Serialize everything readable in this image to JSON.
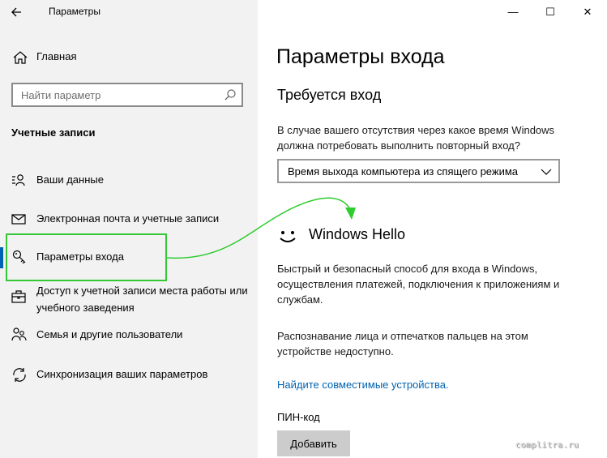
{
  "window": {
    "title": "Параметры",
    "back_icon": "back-arrow-icon",
    "controls": {
      "minimize": "—",
      "maximize": "☐",
      "close": "✕"
    }
  },
  "sidebar": {
    "home_label": "Главная",
    "search_placeholder": "Найти параметр",
    "section_title": "Учетные записи",
    "items": [
      {
        "label": "Ваши данные",
        "icon": "user-info-icon"
      },
      {
        "label": "Электронная почта и учетные записи",
        "icon": "mail-icon"
      },
      {
        "label": "Параметры входа",
        "icon": "key-icon",
        "selected": true
      },
      {
        "label": "Доступ к учетной записи места работы или учебного заведения",
        "icon": "briefcase-icon"
      },
      {
        "label": "Семья и другие пользователи",
        "icon": "people-icon"
      },
      {
        "label": "Синхронизация ваших параметров",
        "icon": "sync-icon"
      }
    ]
  },
  "main": {
    "page_title": "Параметры входа",
    "signin_required": {
      "heading": "Требуется вход",
      "description": "В случае вашего отсутствия через какое время Windows должна потребовать выполнить повторный вход?",
      "dropdown_value": "Время выхода компьютера из спящего режима"
    },
    "windows_hello": {
      "heading": "Windows Hello",
      "description": "Быстрый и безопасный способ для входа в Windows, осуществления платежей, подключения к приложениям и службам.",
      "unavailable_note": "Распознавание лица и отпечатков пальцев на этом устройстве недоступно.",
      "link": "Найдите совместимые устройства."
    },
    "pin": {
      "label": "ПИН-код",
      "add_button": "Добавить"
    }
  },
  "watermark": "complitra.ru",
  "colors": {
    "sidebar_bg": "#f2f2f2",
    "accent": "#0063b1",
    "highlight_green": "#34c834",
    "button_bg": "#cccccc"
  }
}
